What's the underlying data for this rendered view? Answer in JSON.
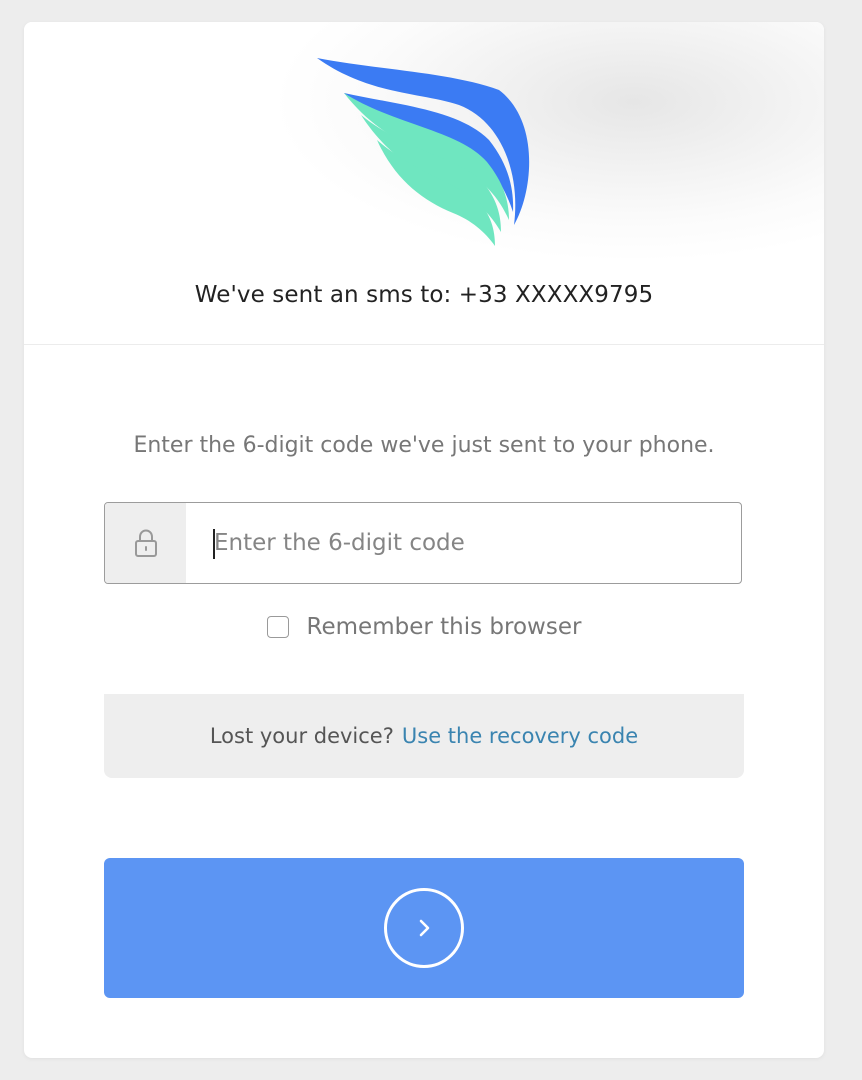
{
  "header": {
    "sent_text": "We've sent an sms to: +33 XXXXX9795",
    "logo_colors": {
      "blue": "#3b7bf3",
      "green": "#6fe6c0"
    }
  },
  "main": {
    "instruction": "Enter the 6-digit code we've just sent to your phone.",
    "code_input": {
      "placeholder": "Enter the 6-digit code",
      "value": ""
    },
    "remember": {
      "label": "Remember this browser",
      "checked": false
    },
    "recovery": {
      "question": "Lost your device?",
      "link_label": "Use the recovery code"
    }
  },
  "submit": {
    "icon": "chevron-right-icon",
    "color": "#5c95f3"
  }
}
